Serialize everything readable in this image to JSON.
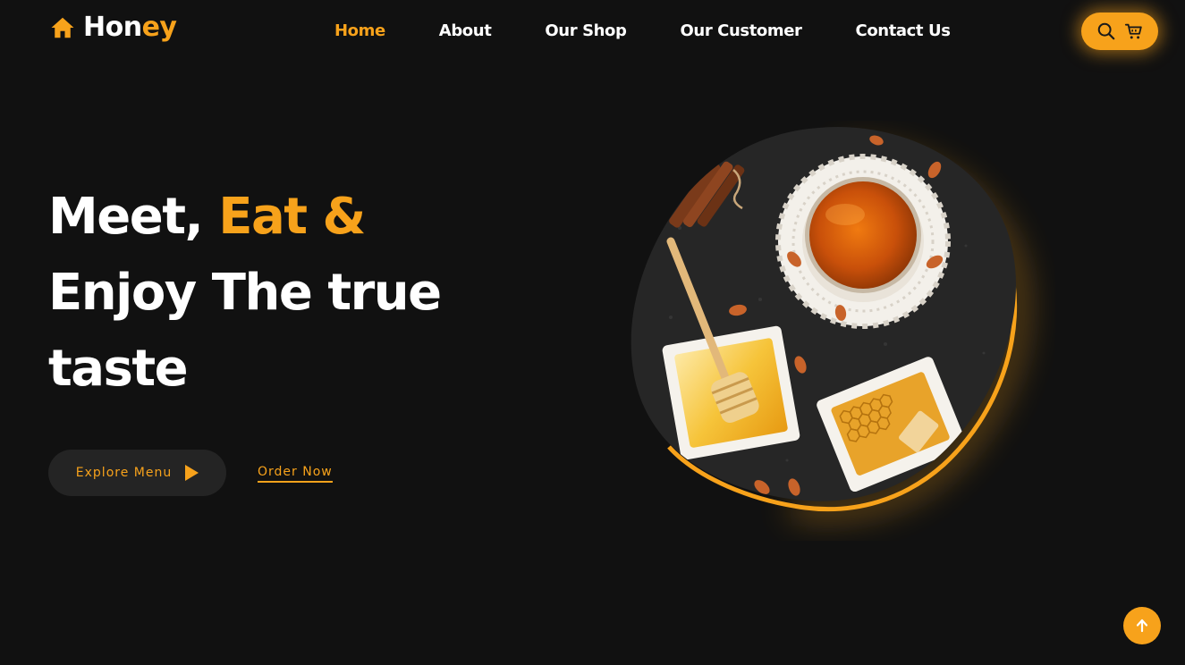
{
  "brand": {
    "logo_part1": "Hon",
    "logo_part2": "ey",
    "logo_icon": "home-icon"
  },
  "nav": {
    "items": [
      {
        "label": "Home",
        "active": true
      },
      {
        "label": "About",
        "active": false
      },
      {
        "label": "Our Shop",
        "active": false
      },
      {
        "label": "Contact Us",
        "active": false
      },
      {
        "label": "Our Customer",
        "active": false
      }
    ],
    "home": "Home",
    "about": "About",
    "shop": "Our Shop",
    "customer": "Our Customer",
    "contact": "Contact Us"
  },
  "header_actions": {
    "search_icon": "search-icon",
    "cart_icon": "cart-icon"
  },
  "hero": {
    "line1_white": "Meet, ",
    "line1_accent": "Eat &",
    "line2": "Enjoy The true",
    "line3": "taste",
    "explore_label": "Explore Menu",
    "order_label": "Order Now",
    "image_subject": "honey-bowl-dipper-honeycomb-almonds"
  },
  "scroll_top_icon": "arrow-up-icon",
  "colors": {
    "background": "#111111",
    "accent": "#f7a21b",
    "button_dark": "#242424",
    "text": "#ffffff"
  }
}
